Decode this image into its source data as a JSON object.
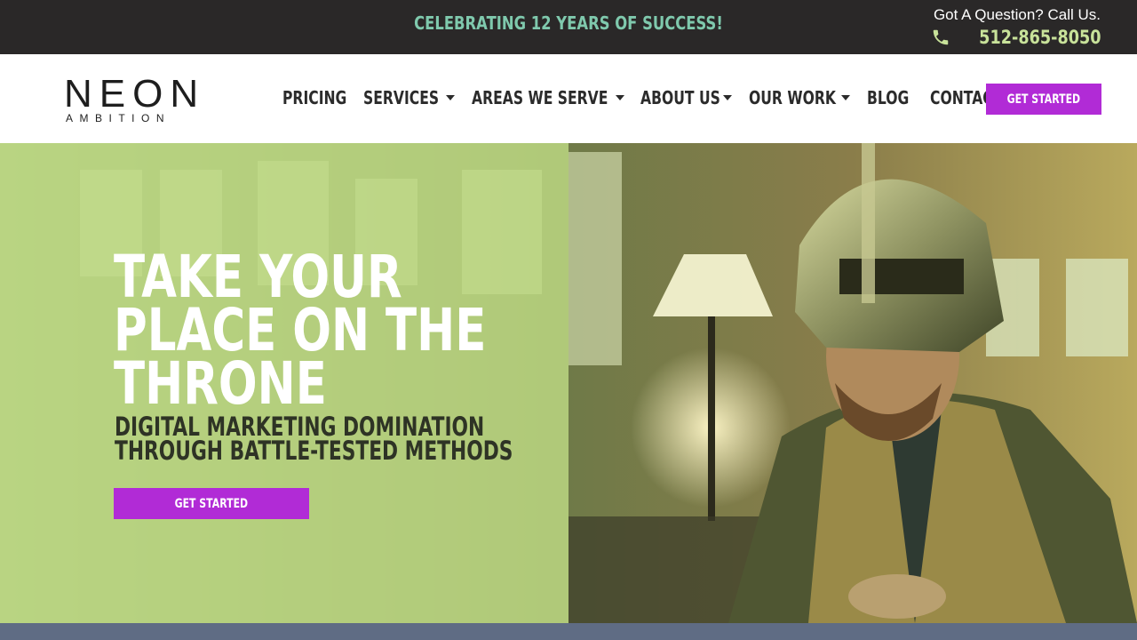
{
  "topbar": {
    "announcement": "CELEBRATING 12 YEARS OF SUCCESS!",
    "question": "Got A Question? Call Us.",
    "phone": "512-865-8050",
    "phone_icon": "phone-icon"
  },
  "logo": {
    "line1": "NEON",
    "line2": "AMBITION"
  },
  "nav": {
    "items": [
      {
        "label": "PRICING",
        "has_dropdown": false
      },
      {
        "label": "SERVICES",
        "has_dropdown": true
      },
      {
        "label": "AREAS WE SERVE",
        "has_dropdown": true
      },
      {
        "label": "ABOUT US",
        "has_dropdown": true
      },
      {
        "label": "OUR WORK",
        "has_dropdown": true
      },
      {
        "label": "BLOG",
        "has_dropdown": false
      },
      {
        "label": "CONTACT US",
        "has_dropdown": false
      }
    ],
    "cta": "GET STARTED"
  },
  "hero": {
    "title_lines": [
      "TAKE YOUR",
      "PLACE ON THE",
      "THRONE"
    ],
    "subtitle_lines": [
      "DIGITAL MARKETING DOMINATION",
      "THROUGH BATTLE-TESTED METHODS"
    ],
    "cta": "GET STARTED"
  },
  "colors": {
    "topbar_bg": "#2a2828",
    "announcement": "#7fc9ad",
    "phone": "#c8e29a",
    "accent": "#b12bd6",
    "overlay": "#bedb84",
    "bottom_strip": "#5f6c84"
  }
}
